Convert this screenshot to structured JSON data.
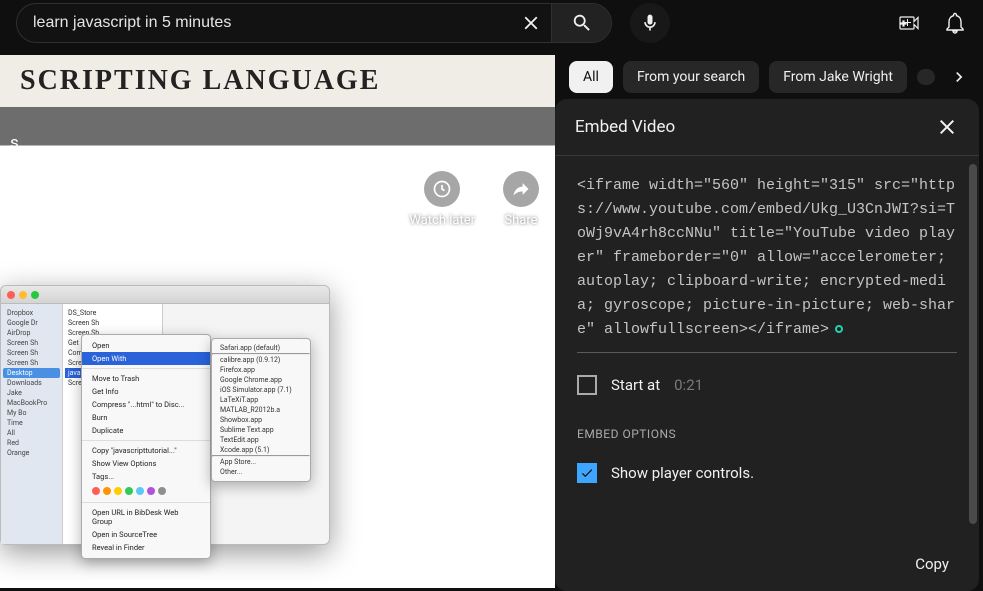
{
  "search": {
    "value": "learn javascript in 5 minutes"
  },
  "video": {
    "whiteboard_text": "SCRIPTING  LANGUAGE",
    "title_suffix": "s",
    "watch_later": "Watch later",
    "share": "Share"
  },
  "chips": {
    "items": [
      "All",
      "From your search",
      "From Jake Wright"
    ],
    "active_index": 0
  },
  "embed": {
    "title": "Embed Video",
    "code": "<iframe width=\"560\" height=\"315\" src=\"https://www.youtube.com/embed/Ukg_U3CnJWI?si=ToWj9vA4rh8ccNNu\" title=\"YouTube video player\" frameborder=\"0\" allow=\"accelerometer; autoplay; clipboard-write; encrypted-media; gyroscope; picture-in-picture; web-share\" allowfullscreen></iframe>",
    "start_at_label": "Start at",
    "start_at_value": "0:21",
    "start_at_checked": false,
    "options_title": "EMBED OPTIONS",
    "show_controls_label": "Show player controls.",
    "show_controls_checked": true,
    "copy_label": "Copy"
  },
  "mac": {
    "sidebar": [
      "Dropbox",
      "Google Dr",
      "AirDrop",
      "Screen Sh",
      "Screen Sh",
      "Screen Sh",
      "Desktop",
      "Downloads",
      "Jake",
      "MacBookPro",
      "My Bo",
      "Time",
      "All",
      "Red",
      "Orange"
    ],
    "sidebar_sel": 6,
    "files": [
      "DS_Store",
      "Screen Sh",
      "Screen Sh",
      "Get ...",
      "Company \"....html\" to Disc...",
      "Screen Sh",
      "javascripttutorial.html",
      "Screen Sh"
    ],
    "files_sel": 6,
    "ctx": [
      "Open",
      "Open With",
      "Move to Trash",
      "Get Info",
      "Compress \"...html\" to Disc...",
      "Burn",
      "Duplicate",
      "Copy \"javascripttutorial...\"",
      "Show View Options",
      "Tags..."
    ],
    "ctx_sel": 1,
    "sub": [
      "Safari.app (default)",
      "calibre.app (0.9.12)",
      "Firefox.app",
      "Google Chrome.app",
      "iOS Simulator.app (7.1)",
      "LaTeXiT.app",
      "MATLAB_R2012b.a",
      "Showbox.app",
      "Sublime Text.app",
      "TextEdit.app",
      "Xcode.app (5.1)",
      "App Store...",
      "Other..."
    ],
    "tag_colors": [
      "#ff5f56",
      "#ff9500",
      "#ffcc00",
      "#34c759",
      "#5ac8fa",
      "#af52de",
      "#8e8e93"
    ]
  }
}
